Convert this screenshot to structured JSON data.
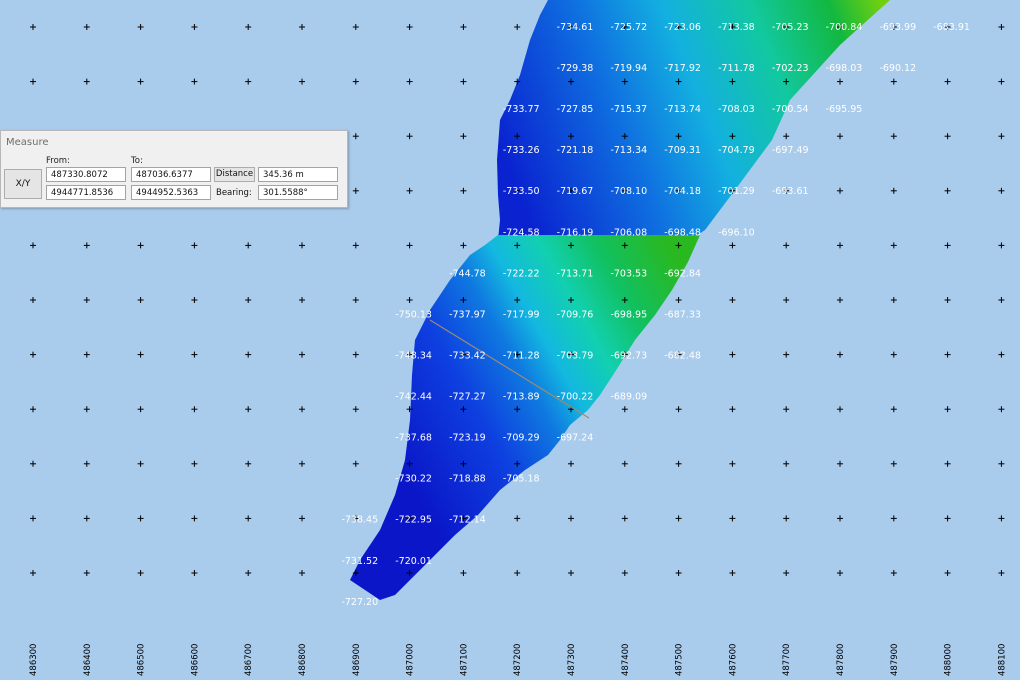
{
  "measure": {
    "title": "Measure",
    "xy_button": "X/Y",
    "from_label": "From:",
    "to_label": "To:",
    "from_x": "487330.8072",
    "from_y": "4944771.8536",
    "to_x": "487036.6377",
    "to_y": "4944952.5363",
    "distance_button": "Distance",
    "distance_value": "345.36 m",
    "bearing_label": "Bearing:",
    "bearing_value": "301.5588°"
  },
  "colors": {
    "background": "#a9cbec",
    "depth_deep": "#0a16c8",
    "depth_mid": "#10d8c8",
    "depth_shallow": "#10b830",
    "measure_line": "#9a8a7a"
  },
  "grid": {
    "eastings": [
      "486300",
      "486400",
      "486500",
      "486600",
      "486700",
      "486800",
      "486900",
      "487000",
      "487100",
      "487200",
      "487300",
      "487400",
      "487500",
      "487600",
      "487700",
      "487800",
      "487900",
      "488000",
      "488100"
    ]
  },
  "depth_labels": [
    {
      "text": "-734.61",
      "col": 10.0,
      "row": 0.0
    },
    {
      "text": "-725.72",
      "col": 11.0,
      "row": 0.0
    },
    {
      "text": "-723.06",
      "col": 12.0,
      "row": 0.0
    },
    {
      "text": "-713.38",
      "col": 13.0,
      "row": 0.0
    },
    {
      "text": "-705.23",
      "col": 14.0,
      "row": 0.0
    },
    {
      "text": "-700.84",
      "col": 15.0,
      "row": 0.0
    },
    {
      "text": "-693.99",
      "col": 16.0,
      "row": 0.0
    },
    {
      "text": "-683.91",
      "col": 17.0,
      "row": 0.0
    },
    {
      "text": "-729.38",
      "col": 10.0,
      "row": 1.0
    },
    {
      "text": "-719.94",
      "col": 11.0,
      "row": 1.0
    },
    {
      "text": "-717.92",
      "col": 12.0,
      "row": 1.0
    },
    {
      "text": "-711.78",
      "col": 13.0,
      "row": 1.0
    },
    {
      "text": "-702.23",
      "col": 14.0,
      "row": 1.0
    },
    {
      "text": "-698.03",
      "col": 15.0,
      "row": 1.0
    },
    {
      "text": "-690.12",
      "col": 16.0,
      "row": 1.0
    },
    {
      "text": "-733.77",
      "col": 9.0,
      "row": 2.0
    },
    {
      "text": "-727.85",
      "col": 10.0,
      "row": 2.0
    },
    {
      "text": "-715.37",
      "col": 11.0,
      "row": 2.0
    },
    {
      "text": "-713.74",
      "col": 12.0,
      "row": 2.0
    },
    {
      "text": "-708.03",
      "col": 13.0,
      "row": 2.0
    },
    {
      "text": "-700.54",
      "col": 14.0,
      "row": 2.0
    },
    {
      "text": "-695.95",
      "col": 15.0,
      "row": 2.0
    },
    {
      "text": "-733.26",
      "col": 9.0,
      "row": 3.0
    },
    {
      "text": "-721.18",
      "col": 10.0,
      "row": 3.0
    },
    {
      "text": "-713.34",
      "col": 11.0,
      "row": 3.0
    },
    {
      "text": "-709.31",
      "col": 12.0,
      "row": 3.0
    },
    {
      "text": "-704.79",
      "col": 13.0,
      "row": 3.0
    },
    {
      "text": "-697.49",
      "col": 14.0,
      "row": 3.0
    },
    {
      "text": "-733.50",
      "col": 9.0,
      "row": 4.0
    },
    {
      "text": "-719.67",
      "col": 10.0,
      "row": 4.0
    },
    {
      "text": "-708.10",
      "col": 11.0,
      "row": 4.0
    },
    {
      "text": "-704.18",
      "col": 12.0,
      "row": 4.0
    },
    {
      "text": "-701.29",
      "col": 13.0,
      "row": 4.0
    },
    {
      "text": "-693.61",
      "col": 14.0,
      "row": 4.0
    },
    {
      "text": "-724.58",
      "col": 9.0,
      "row": 5.0
    },
    {
      "text": "-716.19",
      "col": 10.0,
      "row": 5.0
    },
    {
      "text": "-706.08",
      "col": 11.0,
      "row": 5.0
    },
    {
      "text": "-698.48",
      "col": 12.0,
      "row": 5.0
    },
    {
      "text": "-696.10",
      "col": 13.0,
      "row": 5.0
    },
    {
      "text": "-744.78",
      "col": 8.0,
      "row": 6.0
    },
    {
      "text": "-722.22",
      "col": 9.0,
      "row": 6.0
    },
    {
      "text": "-713.71",
      "col": 10.0,
      "row": 6.0
    },
    {
      "text": "-703.53",
      "col": 11.0,
      "row": 6.0
    },
    {
      "text": "-692.84",
      "col": 12.0,
      "row": 6.0
    },
    {
      "text": "-750.13",
      "col": 7.0,
      "row": 7.0
    },
    {
      "text": "-737.97",
      "col": 8.0,
      "row": 7.0
    },
    {
      "text": "-717.99",
      "col": 9.0,
      "row": 7.0
    },
    {
      "text": "-709.76",
      "col": 10.0,
      "row": 7.0
    },
    {
      "text": "-698.95",
      "col": 11.0,
      "row": 7.0
    },
    {
      "text": "-687.33",
      "col": 12.0,
      "row": 7.0
    },
    {
      "text": "-748.34",
      "col": 7.0,
      "row": 8.0
    },
    {
      "text": "-733.42",
      "col": 8.0,
      "row": 8.0
    },
    {
      "text": "-711.28",
      "col": 9.0,
      "row": 8.0
    },
    {
      "text": "-703.79",
      "col": 10.0,
      "row": 8.0
    },
    {
      "text": "-692.73",
      "col": 11.0,
      "row": 8.0
    },
    {
      "text": "-682.48",
      "col": 12.0,
      "row": 8.0
    },
    {
      "text": "-742.44",
      "col": 7.0,
      "row": 9.0
    },
    {
      "text": "-727.27",
      "col": 8.0,
      "row": 9.0
    },
    {
      "text": "-713.89",
      "col": 9.0,
      "row": 9.0
    },
    {
      "text": "-700.22",
      "col": 10.0,
      "row": 9.0
    },
    {
      "text": "-689.09",
      "col": 11.0,
      "row": 9.0
    },
    {
      "text": "-737.68",
      "col": 7.0,
      "row": 10.0
    },
    {
      "text": "-723.19",
      "col": 8.0,
      "row": 10.0
    },
    {
      "text": "-709.29",
      "col": 9.0,
      "row": 10.0
    },
    {
      "text": "-697.24",
      "col": 10.0,
      "row": 10.0
    },
    {
      "text": "-730.22",
      "col": 7.0,
      "row": 11.0
    },
    {
      "text": "-718.88",
      "col": 8.0,
      "row": 11.0
    },
    {
      "text": "-705.18",
      "col": 9.0,
      "row": 11.0
    },
    {
      "text": "-738.45",
      "col": 6.0,
      "row": 12.0
    },
    {
      "text": "-722.95",
      "col": 7.0,
      "row": 12.0
    },
    {
      "text": "-712.14",
      "col": 8.0,
      "row": 12.0
    },
    {
      "text": "-731.52",
      "col": 6.0,
      "row": 13.0
    },
    {
      "text": "-720.01",
      "col": 7.0,
      "row": 13.0
    },
    {
      "text": "-727.20",
      "col": 6.0,
      "row": 14.0
    }
  ]
}
